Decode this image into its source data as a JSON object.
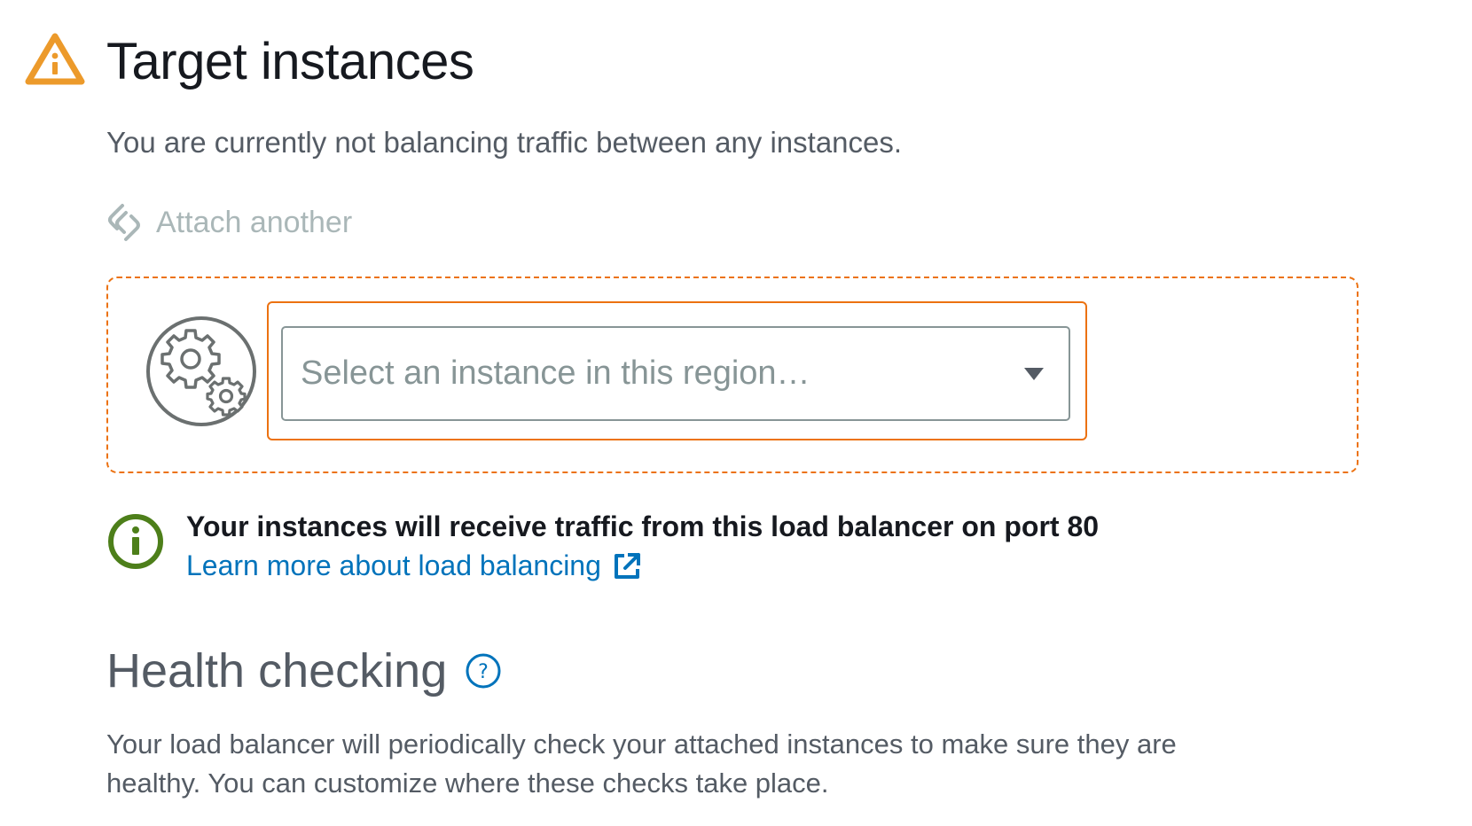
{
  "header": {
    "title": "Target instances",
    "status_icon": "warning-triangle-icon",
    "subtitle": "You are currently not balancing traffic between any instances."
  },
  "attach": {
    "label": "Attach another",
    "icon": "attach-link-icon",
    "enabled": false
  },
  "instance_picker": {
    "icon": "instance-gears-icon",
    "placeholder": "Select an instance in this region…",
    "caret_icon": "dropdown-caret-icon"
  },
  "info": {
    "icon": "info-circle-icon",
    "message": "Your instances will receive traffic from this load balancer on port 80",
    "link_label": "Learn more about load balancing",
    "link_icon": "external-link-icon"
  },
  "health": {
    "title": "Health checking",
    "help_icon": "help-circle-icon",
    "description_line1": "Your load balancer will periodically check your attached instances to make sure they are",
    "description_line2": "healthy. You can customize where these checks take place."
  },
  "colors": {
    "warning": "#ec9a2b",
    "accent_orange": "#ec7211",
    "info_green": "#4d7f1a",
    "link_blue": "#0073bb",
    "title_dark": "#16191f",
    "text_gray": "#545b64",
    "disabled_gray": "#aab7b8"
  }
}
